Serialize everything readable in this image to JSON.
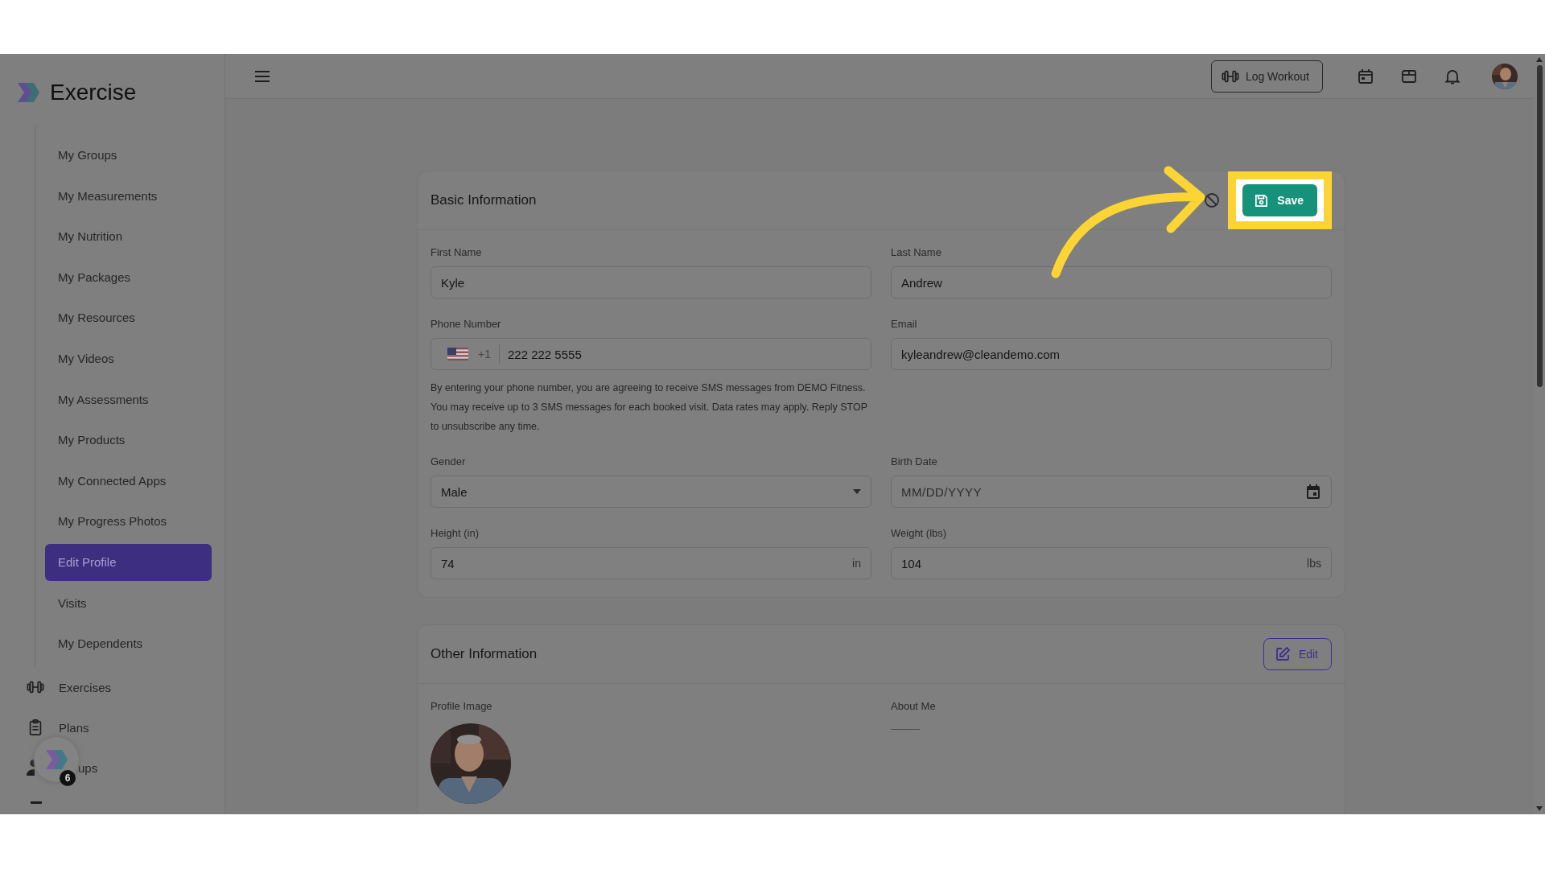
{
  "sidebar": {
    "logo_text": "Exercise",
    "nav": [
      {
        "label": "My Groups",
        "selected": false
      },
      {
        "label": "My Measurements",
        "selected": false
      },
      {
        "label": "My Nutrition",
        "selected": false
      },
      {
        "label": "My Packages",
        "selected": false
      },
      {
        "label": "My Resources",
        "selected": false
      },
      {
        "label": "My Videos",
        "selected": false
      },
      {
        "label": "My Assessments",
        "selected": false
      },
      {
        "label": "My Products",
        "selected": false
      },
      {
        "label": "My Connected Apps",
        "selected": false
      },
      {
        "label": "My Progress Photos",
        "selected": false
      },
      {
        "label": "Edit Profile",
        "selected": true
      },
      {
        "label": "Visits",
        "selected": false
      },
      {
        "label": "My Dependents",
        "selected": false
      }
    ],
    "sections": [
      {
        "kind": "dumbbell",
        "label": "Exercises"
      },
      {
        "kind": "clipboard",
        "label": "Plans"
      },
      {
        "kind": "people",
        "label": "ups"
      }
    ],
    "chat_badge": "6"
  },
  "header": {
    "log_workout": "Log Workout"
  },
  "basic_information": {
    "title": "Basic Information",
    "save": "Save",
    "fields": [
      {
        "kind": "text",
        "label": "First Name",
        "value": "Kyle"
      },
      {
        "kind": "text",
        "label": "Last Name",
        "value": "Andrew"
      },
      {
        "kind": "phone",
        "label": "Phone Number",
        "country_code": "+1",
        "value": "222 222 5555",
        "note": "By entering your phone number, you are agreeing to receive SMS messages from DEMO Fitness. You may receive up to 3 SMS messages for each booked visit. Data rates may apply. Reply STOP to unsubscribe any time."
      },
      {
        "kind": "text",
        "label": "Email",
        "value": "kyleandrew@cleandemo.com"
      },
      {
        "kind": "select",
        "label": "Gender",
        "value": "Male"
      },
      {
        "kind": "date",
        "label": "Birth Date",
        "placeholder": "MM/DD/YYYY"
      },
      {
        "kind": "unit",
        "label": "Height (in)",
        "value": "74",
        "unit": "in"
      },
      {
        "kind": "unit",
        "label": "Weight (lbs)",
        "value": "104",
        "unit": "lbs"
      }
    ]
  },
  "other_information": {
    "title": "Other Information",
    "edit": "Edit",
    "profile_image_label": "Profile Image",
    "about_me_label": "About Me",
    "about_me_value": "———"
  }
}
